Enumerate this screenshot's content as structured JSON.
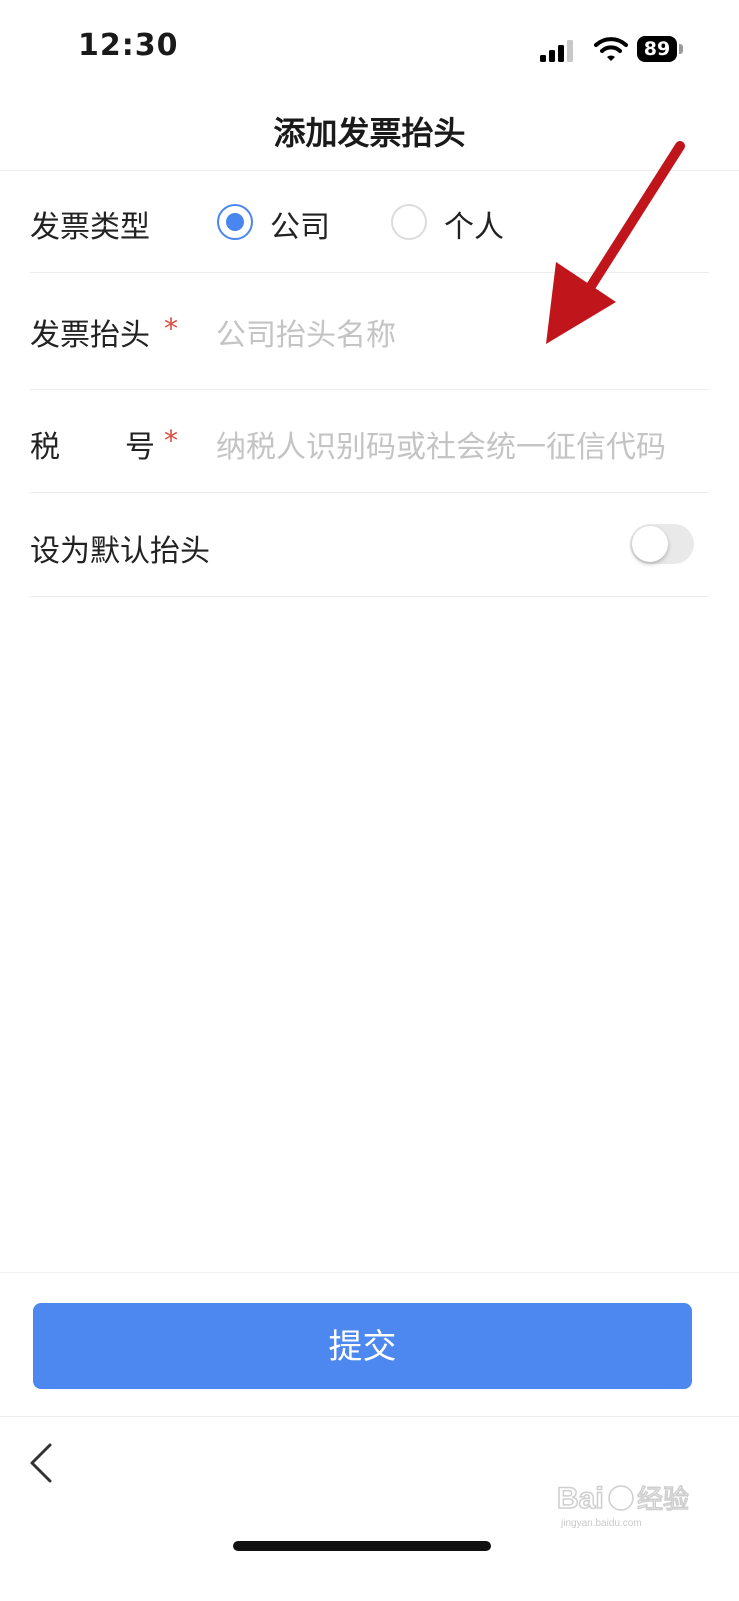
{
  "status_bar": {
    "time": "12:30",
    "battery": "89"
  },
  "nav": {
    "title": "添加发票抬头"
  },
  "form": {
    "invoice_type": {
      "label": "发票类型",
      "options": [
        "公司",
        "个人"
      ],
      "selected": "公司"
    },
    "invoice_title": {
      "label": "发票抬头",
      "required_mark": "*",
      "placeholder": "公司抬头名称"
    },
    "tax_number": {
      "label_left": "税",
      "label_right": "号",
      "required_mark": "*",
      "placeholder": "纳税人识别码或社会统一征信代码"
    },
    "default_title": {
      "label": "设为默认抬头",
      "enabled": false
    }
  },
  "footer": {
    "submit_label": "提交"
  },
  "watermark": {
    "brand": "Baidu 经验",
    "url": "jingyan.baidu.com"
  },
  "colors": {
    "accent": "#4d88f0",
    "required": "#e04a3f",
    "annotation_arrow": "#c0161b"
  }
}
